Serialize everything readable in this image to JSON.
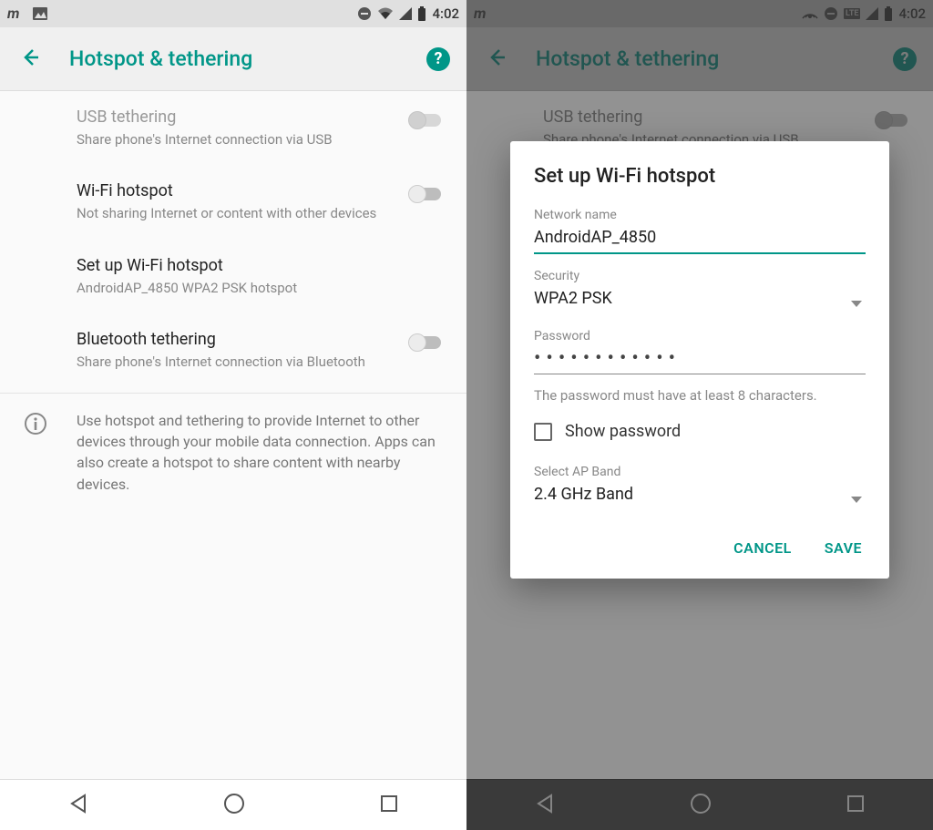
{
  "status": {
    "clock": "4:02"
  },
  "header": {
    "title": "Hotspot & tethering"
  },
  "rows": {
    "usb": {
      "title": "USB tethering",
      "sub": "Share phone's Internet connection via USB"
    },
    "wifi": {
      "title": "Wi-Fi hotspot",
      "sub": "Not sharing Internet or content with other devices"
    },
    "setup": {
      "title": "Set up Wi-Fi hotspot",
      "sub": "AndroidAP_4850 WPA2 PSK hotspot"
    },
    "bt": {
      "title": "Bluetooth tethering",
      "sub": "Share phone's Internet connection via Bluetooth"
    }
  },
  "info": "Use hotspot and tethering to provide Internet to other devices through your mobile data connection. Apps can also create a hotspot to share content with nearby devices.",
  "dialog": {
    "title": "Set up Wi-Fi hotspot",
    "net_label": "Network name",
    "net_value": "AndroidAP_4850",
    "sec_label": "Security",
    "sec_value": "WPA2 PSK",
    "pwd_label": "Password",
    "pwd_value": "••••••••••••",
    "hint": "The password must have at least 8 characters.",
    "show_pwd": "Show password",
    "band_label": "Select AP Band",
    "band_value": "2.4 GHz Band",
    "cancel": "CANCEL",
    "save": "SAVE"
  }
}
